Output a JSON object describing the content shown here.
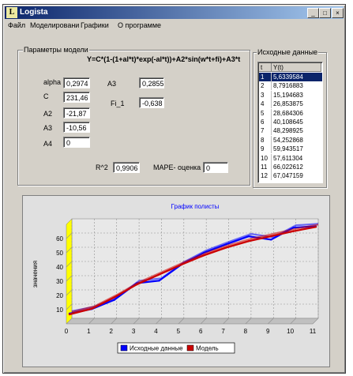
{
  "window": {
    "title": "Logista",
    "icon": "app-icon",
    "min_btn": "_",
    "max_btn": "□",
    "close_btn": "×"
  },
  "menu": [
    "Файл",
    "Моделировани",
    "Графики",
    "О программе"
  ],
  "params": {
    "title": "Параметры модели",
    "formula": "Y=C*(1-(1+al*t)*exp(-al*t))+A2*sin(w*t+fi)+A3*t",
    "fields": {
      "alpha": {
        "label": "alpha",
        "value": "0,2974"
      },
      "c": {
        "label": "C",
        "value": "231,46"
      },
      "a2": {
        "label": "A2",
        "value": "-21,87"
      },
      "a3": {
        "label": "A3",
        "value": "-10,56"
      },
      "a4": {
        "label": "A4",
        "value": "0"
      },
      "a3b": {
        "label": "A3",
        "value": "0,2855"
      },
      "fi1": {
        "label": "Fi_1",
        "value": "-0,638"
      },
      "r2": {
        "label": "R^2",
        "value": "0,9906"
      },
      "mape": {
        "label": "MAPE- оценка",
        "value": "0"
      }
    }
  },
  "source": {
    "title": "Исходные данные",
    "columns": [
      "t",
      "Y(t)"
    ],
    "rows": [
      [
        "1",
        "5,6339584"
      ],
      [
        "2",
        "8,7916883"
      ],
      [
        "3",
        "15,194683"
      ],
      [
        "4",
        "26,853875"
      ],
      [
        "5",
        "28,684306"
      ],
      [
        "6",
        "40,108645"
      ],
      [
        "7",
        "48,298925"
      ],
      [
        "8",
        "54,252868"
      ],
      [
        "9",
        "59,943517"
      ],
      [
        "10",
        "57,611304"
      ],
      [
        "11",
        "66,022612"
      ],
      [
        "12",
        "67,047159"
      ]
    ]
  },
  "chart_data": {
    "type": "line",
    "title": "График полисты",
    "xlabel": "",
    "ylabel": "значения",
    "xlim": [
      0,
      11
    ],
    "ylim": [
      0,
      70
    ],
    "x_ticks": [
      "0",
      "1",
      "2",
      "3",
      "4",
      "5",
      "6",
      "7",
      "8",
      "9",
      "10",
      "11"
    ],
    "y_ticks": [
      "10",
      "20",
      "30",
      "40",
      "50",
      "60"
    ],
    "grid": true,
    "legend_position": "bottom",
    "series": [
      {
        "name": "Исходные данные",
        "color": "#0000ff",
        "x": [
          0,
          1,
          2,
          3,
          4,
          5,
          6,
          7,
          8,
          9,
          10,
          11
        ],
        "y": [
          5.6,
          8.8,
          15.2,
          26.9,
          28.7,
          40.1,
          48.3,
          54.3,
          59.9,
          57.6,
          66.0,
          67.0
        ]
      },
      {
        "name": "Модель",
        "color": "#cc0000",
        "x": [
          0,
          1,
          2,
          3,
          4,
          5,
          6,
          7,
          8,
          9,
          10,
          11
        ],
        "y": [
          5.0,
          9.0,
          17.0,
          26.0,
          33.0,
          40.0,
          46.5,
          52.0,
          56.5,
          60.0,
          63.5,
          66.5
        ]
      }
    ]
  }
}
